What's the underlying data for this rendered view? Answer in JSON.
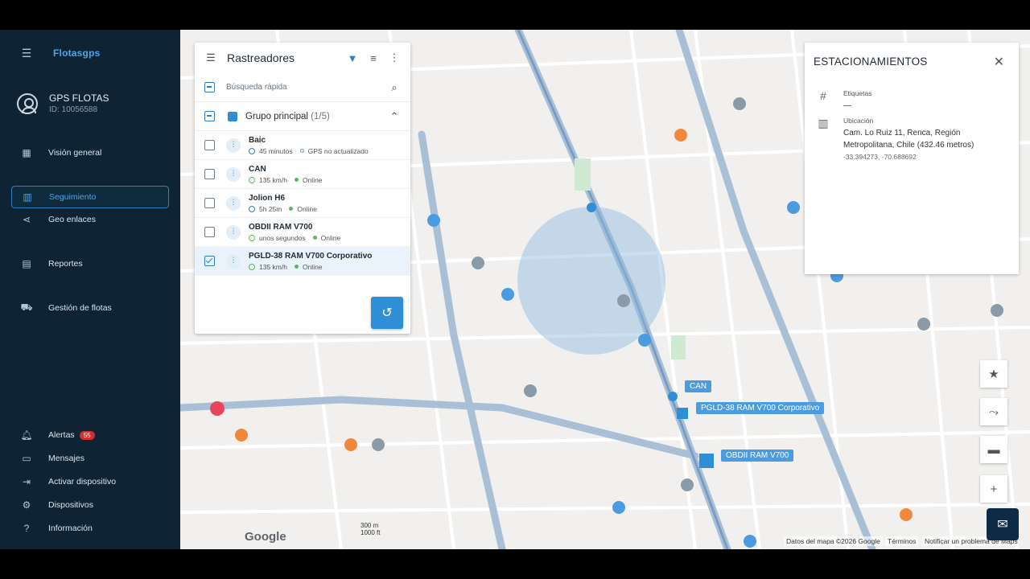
{
  "sidebar": {
    "logo": "Flotasgps",
    "user": {
      "name": "GPS FLOTAS",
      "id": "ID: 10056588"
    },
    "nav": [
      {
        "label": "Visión general",
        "icon": "dashboard-icon"
      },
      {
        "label": "Seguimiento",
        "icon": "map-icon",
        "active": true
      },
      {
        "label": "Geo enlaces",
        "icon": "share-icon"
      },
      {
        "label": "Reportes",
        "icon": "reports-icon"
      },
      {
        "label": "Gestión de flotas",
        "icon": "car-icon"
      }
    ],
    "bottom": [
      {
        "label": "Alertas",
        "icon": "bell-icon",
        "badge": "55"
      },
      {
        "label": "Mensajes",
        "icon": "message-icon"
      },
      {
        "label": "Activar dispositivo",
        "icon": "activate-icon"
      },
      {
        "label": "Dispositivos",
        "icon": "gear-icon"
      },
      {
        "label": "Información",
        "icon": "help-icon"
      }
    ]
  },
  "trackers": {
    "title": "Rastreadores",
    "search_placeholder": "Búsqueda rápida",
    "group": {
      "name": "Grupo principal",
      "count": "(1/5)"
    },
    "items": [
      {
        "name": "Baic",
        "status1": "45 minutos",
        "status2": "GPS no actualizado",
        "checked": false
      },
      {
        "name": "CAN",
        "status1": "135 km/h",
        "status2": "Online",
        "checked": false
      },
      {
        "name": "Jolion H6",
        "status1": "5h 25m",
        "status2": "Online",
        "checked": false
      },
      {
        "name": "OBDII RAM V700",
        "status1": "unos segundos",
        "status2": "Online",
        "checked": false
      },
      {
        "name": "PGLD-38 RAM V700 Corporativo",
        "status1": "135 km/h",
        "status2": "Online",
        "checked": true
      }
    ]
  },
  "parking": {
    "title": "ESTACIONAMIENTOS",
    "tags_label": "Etiquetas",
    "tags_value": "—",
    "location_label": "Ubicación",
    "location_value": "Cam. Lo Ruiz 11, Renca, Región Metropolitana, Chile (432.46 metros)",
    "coords": "-33.394273, -70.688692"
  },
  "map": {
    "vehicle_labels": [
      "CAN",
      "PGLD-38 RAM V700 Corporativo",
      "OBDII RAM V700"
    ],
    "attribution": "Datos del mapa ©2026 Google",
    "terms": "Términos",
    "report": "Notificar un problema de Maps",
    "scale_m": "300 m",
    "scale_ft": "1000 ft",
    "brand": "Google"
  },
  "colors": {
    "sidebar_bg": "#0e2333",
    "accent": "#2f8fd6",
    "online": "#5cb85c",
    "alert_badge": "#d32f2f"
  }
}
